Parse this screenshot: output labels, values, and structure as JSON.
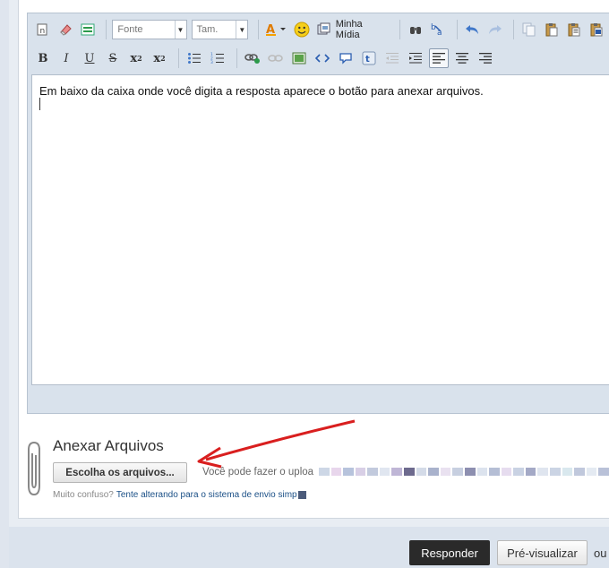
{
  "editor": {
    "toolbar1": {
      "font_select": "Fonte",
      "size_select": "Tam.",
      "media_label": "Minha Mídia"
    },
    "content": "Em baixo da caixa onde você digita a resposta aparece o botão para anexar arquivos."
  },
  "toolbar2": {
    "bold": "B",
    "italic": "I",
    "underline": "U",
    "strike": "S",
    "subscript": "x",
    "subscript_sub": "2",
    "superscript": "x",
    "superscript_sup": "2"
  },
  "attachments": {
    "title": "Anexar Arquivos",
    "choose_button": "Escolha os arquivos...",
    "upload_hint": "Você pode fazer o uploa",
    "confused_prefix": "Muito confuso?",
    "confused_link": "Tente alterando para o sistema de envio simp"
  },
  "footer": {
    "respond_button": "Responder",
    "preview_button": "Pré-visualizar",
    "or_text": "ou"
  },
  "colors": {
    "annotation_arrow": "#d91f1f",
    "respond_button_bg": "#2a2a2a",
    "link": "#1a4f86"
  }
}
